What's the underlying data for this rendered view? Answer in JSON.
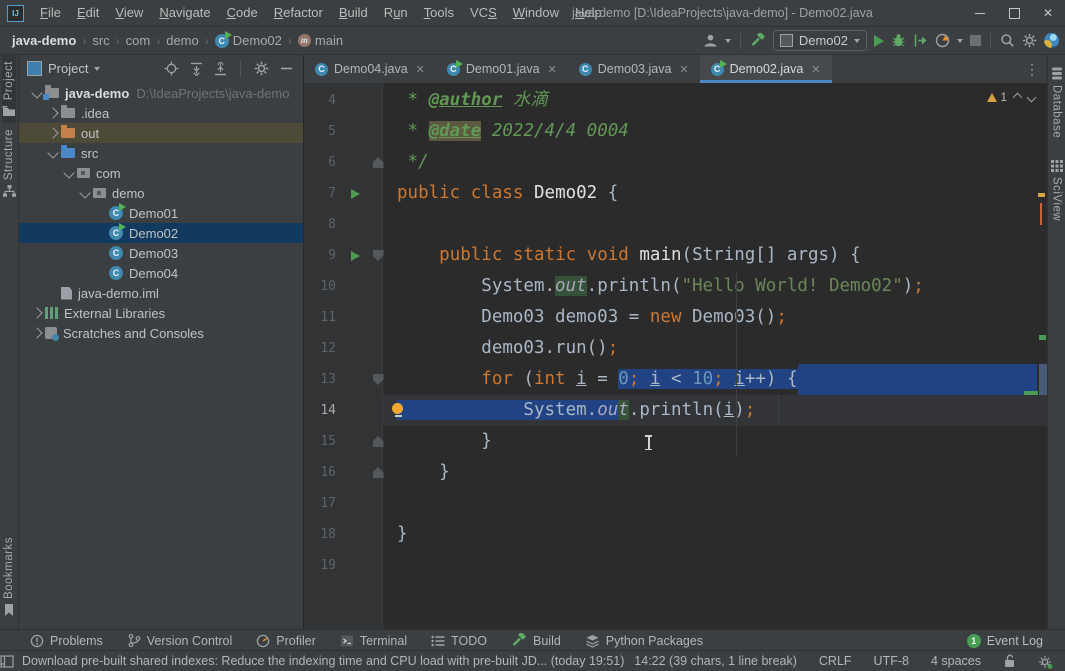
{
  "window": {
    "title": "java-demo [D:\\IdeaProjects\\java-demo] - Demo02.java",
    "menu": [
      {
        "label": "File",
        "m": 0
      },
      {
        "label": "Edit",
        "m": 0
      },
      {
        "label": "View",
        "m": 0
      },
      {
        "label": "Navigate",
        "m": 0
      },
      {
        "label": "Code",
        "m": 0
      },
      {
        "label": "Refactor",
        "m": 0
      },
      {
        "label": "Build",
        "m": 0
      },
      {
        "label": "Run",
        "m": 1
      },
      {
        "label": "Tools",
        "m": 0
      },
      {
        "label": "VCS",
        "m": 2
      },
      {
        "label": "Window",
        "m": 0
      },
      {
        "label": "Help",
        "m": 0
      }
    ]
  },
  "toolbar": {
    "breadcrumbs": [
      "java-demo",
      "src",
      "com",
      "demo",
      "Demo02",
      "main"
    ],
    "run_config": "Demo02"
  },
  "stripes": {
    "left": [
      "Project",
      "Structure",
      "Bookmarks"
    ],
    "right": [
      "Database",
      "SciView"
    ]
  },
  "project": {
    "title": "Project",
    "tree": [
      {
        "level": 0,
        "chevron": "down",
        "icon": "folder-root",
        "label": "java-demo",
        "suffix": "D:\\IdeaProjects\\java-demo",
        "bold": true
      },
      {
        "level": 1,
        "chevron": "right",
        "icon": "folder",
        "label": ".idea"
      },
      {
        "level": 1,
        "chevron": "right",
        "icon": "folder-out",
        "label": "out",
        "highlight": "olive"
      },
      {
        "level": 1,
        "chevron": "down",
        "icon": "folder-src",
        "label": "src"
      },
      {
        "level": 2,
        "chevron": "down",
        "icon": "pkg",
        "label": "com"
      },
      {
        "level": 3,
        "chevron": "down",
        "icon": "pkg",
        "label": "demo"
      },
      {
        "level": 4,
        "chevron": null,
        "icon": "class-run",
        "label": "Demo01"
      },
      {
        "level": 4,
        "chevron": null,
        "icon": "class-run",
        "label": "Demo02",
        "selected": true
      },
      {
        "level": 4,
        "chevron": null,
        "icon": "class",
        "label": "Demo03"
      },
      {
        "level": 4,
        "chevron": null,
        "icon": "class",
        "label": "Demo04"
      },
      {
        "level": 1,
        "chevron": null,
        "icon": "iml",
        "label": "java-demo.iml"
      },
      {
        "level": 0,
        "chevron": "right",
        "icon": "lib",
        "label": "External Libraries"
      },
      {
        "level": 0,
        "chevron": "right",
        "icon": "scratch",
        "label": "Scratches and Consoles"
      }
    ]
  },
  "tabs": [
    {
      "label": "Demo04.java",
      "run": false,
      "active": false
    },
    {
      "label": "Demo01.java",
      "run": true,
      "active": false
    },
    {
      "label": "Demo03.java",
      "run": false,
      "active": false
    },
    {
      "label": "Demo02.java",
      "run": true,
      "active": true
    }
  ],
  "editor": {
    "warning_count": "1",
    "lines": [
      {
        "num": "4",
        "tokens": [
          [
            "com",
            " * "
          ],
          [
            "tag",
            "@author"
          ],
          [
            "com",
            " 水滴"
          ]
        ]
      },
      {
        "num": "5",
        "tokens": [
          [
            "com",
            " * "
          ],
          [
            "tag date-hl",
            "@date"
          ],
          [
            "com",
            " 2022/4/4 0004"
          ]
        ]
      },
      {
        "num": "6",
        "fold": "up",
        "tokens": [
          [
            "com",
            " */"
          ]
        ]
      },
      {
        "num": "7",
        "icon": "run",
        "tokens": [
          [
            "kw",
            "public"
          ],
          [
            "txt",
            " "
          ],
          [
            "kw",
            "class"
          ],
          [
            "txt",
            " "
          ],
          [
            "name",
            "Demo02"
          ],
          [
            "txt",
            " {"
          ]
        ]
      },
      {
        "num": "8",
        "tokens": []
      },
      {
        "num": "9",
        "icon": "run",
        "fold": "down",
        "tokens": [
          [
            "txt",
            "    "
          ],
          [
            "kw",
            "public"
          ],
          [
            "txt",
            " "
          ],
          [
            "kw",
            "static"
          ],
          [
            "txt",
            " "
          ],
          [
            "kw",
            "void"
          ],
          [
            "txt",
            " "
          ],
          [
            "name",
            "main"
          ],
          [
            "txt",
            "(String[] args) {"
          ]
        ]
      },
      {
        "num": "10",
        "tokens": [
          [
            "txt",
            "        System."
          ],
          [
            "field occ",
            "out"
          ],
          [
            "txt",
            ".println("
          ],
          [
            "str",
            "\"Hello World! Demo02\""
          ],
          [
            "txt",
            ")"
          ],
          [
            "semi",
            ";"
          ]
        ]
      },
      {
        "num": "11",
        "tokens": [
          [
            "txt",
            "        Demo03 demo03 = "
          ],
          [
            "kw",
            "new"
          ],
          [
            "txt",
            " Demo03()"
          ],
          [
            "semi",
            ";"
          ]
        ]
      },
      {
        "num": "12",
        "tokens": [
          [
            "txt",
            "        demo03.run()"
          ],
          [
            "semi",
            ";"
          ]
        ]
      },
      {
        "num": "13",
        "fold": "down",
        "sel_to_eol": true,
        "tokens": [
          [
            "txt",
            "        "
          ],
          [
            "kw",
            "for"
          ],
          [
            "txt",
            " ("
          ],
          [
            "kw",
            "int"
          ],
          [
            "txt",
            " "
          ],
          [
            "ul",
            "i"
          ],
          [
            "txt",
            " = "
          ],
          [
            "num sel",
            "0"
          ],
          [
            "semi sel",
            ";"
          ],
          [
            "txt sel",
            " "
          ],
          [
            "ul sel",
            "i"
          ],
          [
            "txt sel",
            " < "
          ],
          [
            "num sel",
            "10"
          ],
          [
            "semi sel",
            ";"
          ],
          [
            "txt sel",
            " "
          ],
          [
            "ul sel",
            "i"
          ],
          [
            "txt sel",
            "++) {"
          ]
        ]
      },
      {
        "num": "14",
        "icon": "bulb",
        "row_highlight": true,
        "tokens": [
          [
            "txt sel",
            "            System."
          ],
          [
            "field sel",
            "ou"
          ],
          [
            "field occ",
            "t"
          ],
          [
            "txt",
            ".println("
          ],
          [
            "ul",
            "i"
          ],
          [
            "txt",
            ")"
          ],
          [
            "semi",
            ";"
          ]
        ]
      },
      {
        "num": "15",
        "fold": "up",
        "tokens": [
          [
            "txt",
            "        }"
          ]
        ]
      },
      {
        "num": "16",
        "fold": "up",
        "tokens": [
          [
            "txt",
            "    }"
          ]
        ]
      },
      {
        "num": "17",
        "tokens": []
      },
      {
        "num": "18",
        "tokens": [
          [
            "txt",
            "}"
          ]
        ]
      },
      {
        "num": "19",
        "tokens": []
      }
    ]
  },
  "bottom_bar": {
    "items": [
      "Problems",
      "Version Control",
      "Profiler",
      "Terminal",
      "TODO",
      "Build",
      "Python Packages"
    ],
    "event_log": "Event Log",
    "event_badge": "1"
  },
  "status_bar": {
    "message": "Download pre-built shared indexes: Reduce the indexing time and CPU load with pre-built JD... (today 19:51)",
    "caret": "14:22 (39 chars, 1 line break)",
    "line_ending": "CRLF",
    "encoding": "UTF-8",
    "indent": "4 spaces"
  },
  "colors": {
    "accent": "#4a88c7",
    "selection": "#214283",
    "keyword": "#cc7832",
    "string": "#6a8759",
    "comment": "#629755",
    "number": "#6897bb",
    "warning_orange": "#d9a343",
    "run_green": "#4d9b53",
    "editor_bg": "#2b2b2b",
    "panel_bg": "#3c3f41"
  }
}
